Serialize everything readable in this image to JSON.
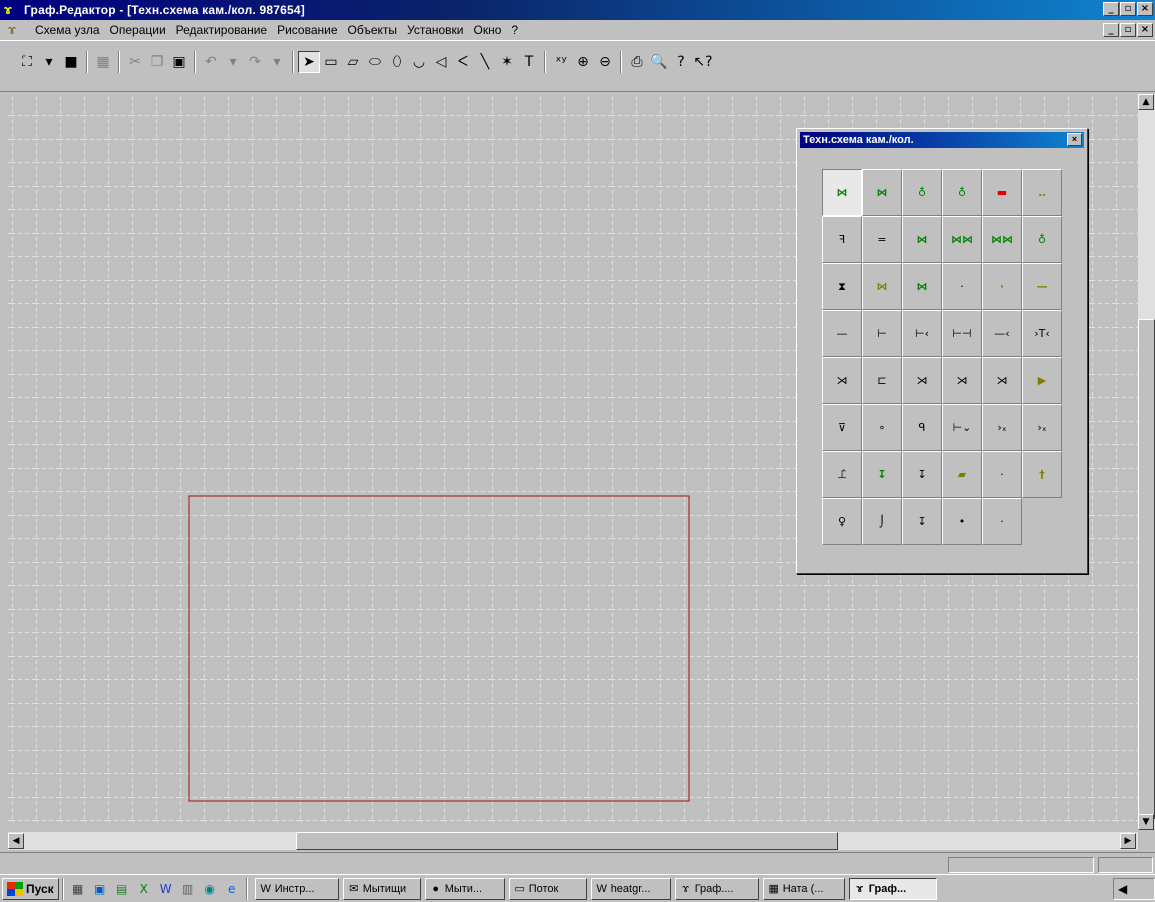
{
  "window": {
    "title": "Граф.Редактор - [Техн.схема кам./кол.  987654]",
    "buttons": {
      "minimize": "_",
      "maximize": "▫",
      "close": "×"
    }
  },
  "menu": {
    "items": [
      "Схема узла",
      "Операции",
      "Редактирование",
      "Рисование",
      "Объекты",
      "Установки",
      "Окно",
      "?"
    ]
  },
  "toolbar": {
    "buttons": [
      {
        "name": "binoculars-icon",
        "glyph": "⛶",
        "dim": false
      },
      {
        "name": "dropdown-arrow-icon",
        "glyph": "▾",
        "dim": false
      },
      {
        "name": "save-icon",
        "glyph": "■",
        "dim": false
      },
      {
        "sep": true
      },
      {
        "name": "stamp-icon",
        "glyph": "▦",
        "dim": true
      },
      {
        "sep": true
      },
      {
        "name": "cut-icon",
        "glyph": "✂",
        "dim": true
      },
      {
        "name": "copy-icon",
        "glyph": "❐",
        "dim": true
      },
      {
        "name": "paste-icon",
        "glyph": "▣",
        "dim": false
      },
      {
        "sep": true
      },
      {
        "name": "undo-icon",
        "glyph": "↶",
        "dim": true
      },
      {
        "name": "undo-dropdown-icon",
        "glyph": "▾",
        "dim": true
      },
      {
        "name": "redo-icon",
        "glyph": "↷",
        "dim": true
      },
      {
        "name": "redo-dropdown-icon",
        "glyph": "▾",
        "dim": true
      },
      {
        "sep": true
      },
      {
        "name": "pointer-icon",
        "glyph": "➤",
        "dim": false,
        "sel": true
      },
      {
        "name": "rectangle-icon",
        "glyph": "▭",
        "dim": false
      },
      {
        "name": "parallelogram-icon",
        "glyph": "▱",
        "dim": false
      },
      {
        "name": "rounded-rect-icon",
        "glyph": "⬭",
        "dim": false
      },
      {
        "name": "ellipse-icon",
        "glyph": "⬯",
        "dim": false
      },
      {
        "name": "arc-icon",
        "glyph": "◡",
        "dim": false
      },
      {
        "name": "polygon-icon",
        "glyph": "◁",
        "dim": false
      },
      {
        "name": "polyline-icon",
        "glyph": "ᐸ",
        "dim": false
      },
      {
        "name": "line-icon",
        "glyph": "╲",
        "dim": false
      },
      {
        "name": "arrow-line-icon",
        "glyph": "✶",
        "dim": false
      },
      {
        "name": "text-icon",
        "glyph": "T",
        "dim": false
      },
      {
        "sep": true
      },
      {
        "name": "xy-icon",
        "glyph": "ˣʸ",
        "dim": false
      },
      {
        "name": "zoom-in-icon",
        "glyph": "⊕",
        "dim": false
      },
      {
        "name": "zoom-out-icon",
        "glyph": "⊖",
        "dim": false
      },
      {
        "sep": true
      },
      {
        "name": "print-icon",
        "glyph": "⎙",
        "dim": false
      },
      {
        "name": "print-preview-icon",
        "glyph": "🔍",
        "dim": false
      },
      {
        "name": "help-icon",
        "glyph": "?",
        "dim": false
      },
      {
        "name": "context-help-icon",
        "glyph": "↖?",
        "dim": false
      }
    ]
  },
  "palette": {
    "title": "Техн.схема кам./кол.",
    "cells": [
      [
        {
          "g": "⋈",
          "c": "g",
          "pressed": true
        },
        {
          "g": "⋈",
          "c": "g"
        },
        {
          "g": "♁",
          "c": "g"
        },
        {
          "g": "♁",
          "c": "g"
        },
        {
          "g": "▬",
          "c": "r"
        },
        {
          "g": "‥",
          "c": "o"
        }
      ],
      [
        {
          "g": "ꟻ",
          "c": ""
        },
        {
          "g": "=",
          "c": ""
        },
        {
          "g": "⋈",
          "c": "g"
        },
        {
          "g": "⋈⋈",
          "c": "g"
        },
        {
          "g": "⋈⋈",
          "c": "g"
        },
        {
          "g": "♁",
          "c": "g"
        }
      ],
      [
        {
          "g": "⧗",
          "c": ""
        },
        {
          "g": "⋈",
          "c": "o"
        },
        {
          "g": "⋈",
          "c": "g"
        },
        {
          "g": "·",
          "c": ""
        },
        {
          "g": "·",
          "c": "o"
        },
        {
          "g": "—",
          "c": "o"
        }
      ],
      [
        {
          "g": "—",
          "c": ""
        },
        {
          "g": "⊢",
          "c": ""
        },
        {
          "g": "⊢‹",
          "c": ""
        },
        {
          "g": "⊢⊣",
          "c": ""
        },
        {
          "g": "—‹",
          "c": ""
        },
        {
          "g": "›T‹",
          "c": ""
        }
      ],
      [
        {
          "g": "⋊",
          "c": ""
        },
        {
          "g": "⊏",
          "c": ""
        },
        {
          "g": "⋊",
          "c": ""
        },
        {
          "g": "⋊",
          "c": ""
        },
        {
          "g": "⋊",
          "c": ""
        },
        {
          "g": "▶",
          "c": "o"
        }
      ],
      [
        {
          "g": "⊽",
          "c": ""
        },
        {
          "g": "∘",
          "c": ""
        },
        {
          "g": "ᑫ",
          "c": ""
        },
        {
          "g": "⊢⌄",
          "c": ""
        },
        {
          "g": "›ₓ",
          "c": ""
        },
        {
          "g": "›ₓ",
          "c": ""
        }
      ],
      [
        {
          "g": "⊥̂",
          "c": ""
        },
        {
          "g": "↧",
          "c": "g"
        },
        {
          "g": "↧",
          "c": ""
        },
        {
          "g": "▰",
          "c": "o"
        },
        {
          "g": "·",
          "c": ""
        },
        {
          "g": "†",
          "c": "o"
        }
      ],
      [
        {
          "g": "♀",
          "c": ""
        },
        {
          "g": "⌡",
          "c": ""
        },
        {
          "g": "↧",
          "c": ""
        },
        {
          "g": "•",
          "c": ""
        },
        {
          "g": "·",
          "c": ""
        }
      ]
    ]
  },
  "taskbar": {
    "start_label": "Пуск",
    "quick_icons": [
      "desktop-icon",
      "explorer-icon",
      "calc-icon",
      "excel-icon",
      "word-icon",
      "app-icon",
      "outlook-icon",
      "ie-icon"
    ],
    "tasks": [
      {
        "label": "Инстр...",
        "icon": "word-doc-icon",
        "glyph": "W",
        "active": false
      },
      {
        "label": "Мытищи",
        "icon": "mail-icon",
        "glyph": "✉",
        "active": false
      },
      {
        "label": "Мыти...",
        "icon": "globe-icon",
        "glyph": "●",
        "active": false
      },
      {
        "label": "Поток",
        "icon": "folder-icon",
        "glyph": "▭",
        "active": false
      },
      {
        "label": "heatgr...",
        "icon": "word-doc-icon",
        "glyph": "W",
        "active": false
      },
      {
        "label": "Граф....",
        "icon": "graph-editor-icon",
        "glyph": "ɤ",
        "active": false
      },
      {
        "label": "Ната (...",
        "icon": "app-window-icon",
        "glyph": "▦",
        "active": false
      },
      {
        "label": "Граф...",
        "icon": "graph-editor-icon",
        "glyph": "ɤ",
        "active": true
      }
    ]
  }
}
